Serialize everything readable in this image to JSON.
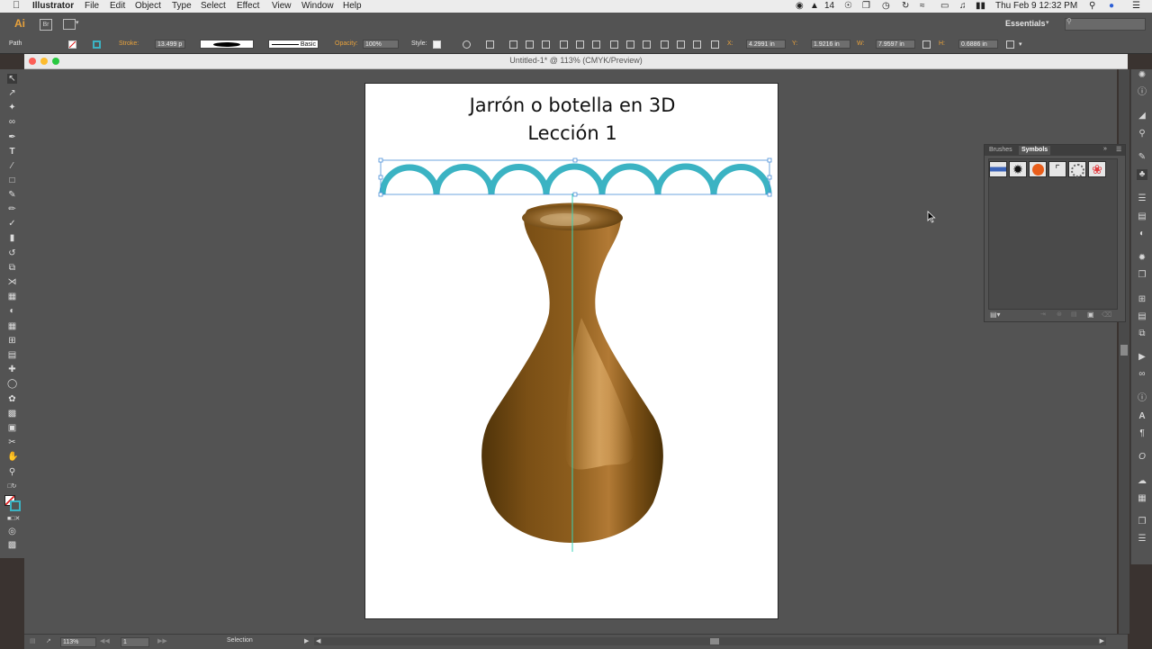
{
  "menubar": {
    "app": "Illustrator",
    "items": [
      "File",
      "Edit",
      "Object",
      "Type",
      "Select",
      "Effect",
      "View",
      "Window",
      "Help"
    ],
    "notification_count": "14",
    "clock": "Thu Feb 9  12:32 PM"
  },
  "appbar": {
    "logo": "Ai",
    "bridge": "Br",
    "workspace": "Essentials",
    "search_placeholder": ""
  },
  "controlbar": {
    "selection_type": "Path",
    "stroke_label": "Stroke:",
    "stroke_value": "13.499 p",
    "profile_label": "Basic",
    "opacity_label": "Opacity:",
    "opacity_value": "100%",
    "style_label": "Style:",
    "x_label": "X:",
    "x_value": "4.2991 in",
    "y_label": "Y:",
    "y_value": "1.9216 in",
    "w_label": "W:",
    "w_value": "7.9597 in",
    "h_label": "H:",
    "h_value": "0.6886 in"
  },
  "document": {
    "title": "Untitled-1* @ 113% (CMYK/Preview)",
    "heading_line1": "Jarrón o botella en 3D",
    "heading_line2": "Lección 1"
  },
  "panel": {
    "tabs": [
      "Brushes",
      "Symbols"
    ],
    "active_tab": "Symbols"
  },
  "statusbar": {
    "zoom": "113%",
    "artboard": "1",
    "tool": "Selection"
  },
  "colors": {
    "accent_orange": "#e8a23c",
    "scallop": "#3bb3c3",
    "vase_dark": "#5a3a0d",
    "vase_mid": "#8a5a1c",
    "vase_light": "#d7a45a",
    "guide": "#39d3b8"
  }
}
